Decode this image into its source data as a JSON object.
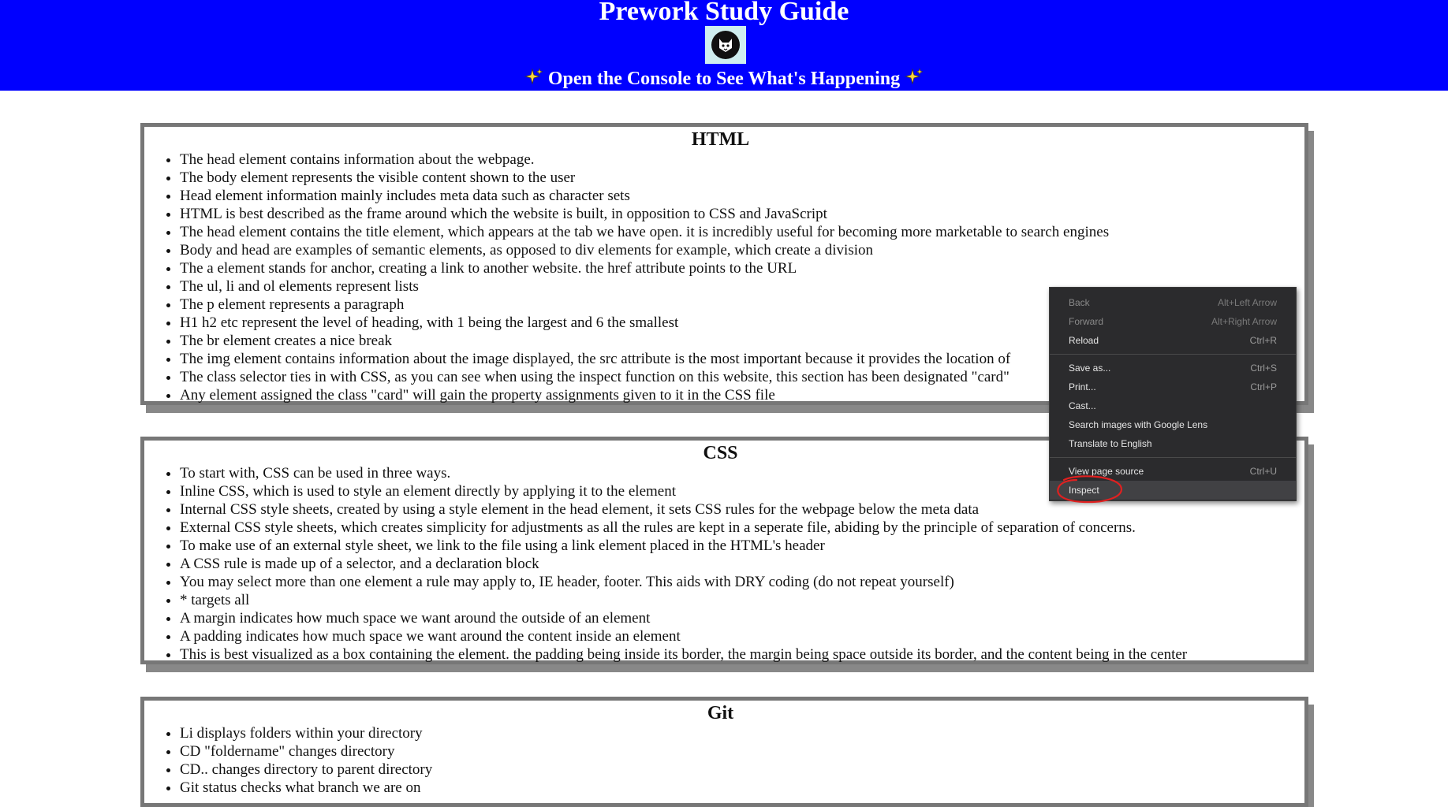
{
  "header": {
    "title": "Prework Study Guide",
    "tagline": "Open the Console to See What's Happening",
    "tagline_icon": "sparkles-icon",
    "logo_icon": "cat-avatar-icon"
  },
  "colors": {
    "header_bg": "#0000ff",
    "card_border": "#777777",
    "card_shadow": "#888888",
    "menu_bg": "#2b2b2d",
    "annotation": "#e02020"
  },
  "sections": [
    {
      "title": "HTML",
      "items": [
        "The head element contains information about the webpage.",
        "The body element represents the visible content shown to the user",
        "Head element information mainly includes meta data such as character sets",
        "HTML is best described as the frame around which the website is built, in opposition to CSS and JavaScript",
        "The head element contains the title element, which appears at the tab we have open. it is incredibly useful for becoming more marketable to search engines",
        "Body and head are examples of semantic elements, as opposed to div elements for example, which create a division",
        "The a element stands for anchor, creating a link to another website. the href attribute points to the URL",
        "The ul, li and ol elements represent lists",
        "The p element represents a paragraph",
        "H1 h2 etc represent the level of heading, with 1 being the largest and 6 the smallest",
        "The br element creates a nice break",
        "The img element contains information about the image displayed, the src attribute is the most important because it provides the location of",
        "The class selector ties in with CSS, as you can see when using the inspect function on this website, this section has been designated \"card\"",
        "Any element assigned the class \"card\" will gain the property assignments given to it in the CSS file"
      ]
    },
    {
      "title": "CSS",
      "items": [
        "To start with, CSS can be used in three ways.",
        "Inline CSS, which is used to style an element directly by applying it to the element",
        "Internal CSS style sheets, created by using a style element in the head element, it sets CSS rules for the webpage below the meta data",
        "External CSS style sheets, which creates simplicity for adjustments as all the rules are kept in a seperate file, abiding by the principle of separation of concerns.",
        "To make use of an external style sheet, we link to the file using a link element placed in the HTML's header",
        "A CSS rule is made up of a selector, and a declaration block",
        "You may select more than one element a rule may apply to, IE header, footer. This aids with DRY coding (do not repeat yourself)",
        "* targets all",
        "A margin indicates how much space we want around the outside of an element",
        "A padding indicates how much space we want around the content inside an element",
        "This is best visualized as a box containing the element. the padding being inside its border, the margin being space outside its border, and the content being in the center"
      ]
    },
    {
      "title": "Git",
      "items": [
        "Li displays folders within your directory",
        "CD \"foldername\" changes directory",
        "CD.. changes directory to parent directory",
        "Git status checks what branch we are on"
      ]
    }
  ],
  "context_menu": {
    "items": [
      {
        "label": "Back",
        "shortcut": "Alt+Left Arrow",
        "disabled": true
      },
      {
        "label": "Forward",
        "shortcut": "Alt+Right Arrow",
        "disabled": true
      },
      {
        "label": "Reload",
        "shortcut": "Ctrl+R",
        "disabled": false
      },
      {
        "separator": true
      },
      {
        "label": "Save as...",
        "shortcut": "Ctrl+S",
        "disabled": false
      },
      {
        "label": "Print...",
        "shortcut": "Ctrl+P",
        "disabled": false
      },
      {
        "label": "Cast...",
        "shortcut": "",
        "disabled": false
      },
      {
        "label": "Search images with Google Lens",
        "shortcut": "",
        "disabled": false
      },
      {
        "label": "Translate to English",
        "shortcut": "",
        "disabled": false
      },
      {
        "separator": true
      },
      {
        "label": "View page source",
        "shortcut": "Ctrl+U",
        "disabled": false
      },
      {
        "label": "Inspect",
        "shortcut": "",
        "disabled": false,
        "highlighted": true
      }
    ]
  }
}
